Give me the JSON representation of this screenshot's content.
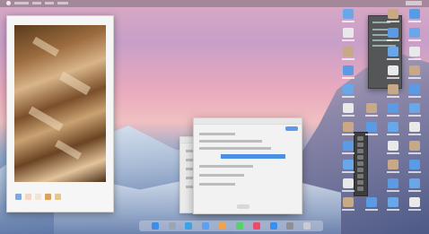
{
  "desktop": {
    "wallpaper": "mountain-landscape",
    "colors": {
      "sky_top": "#d9a9c4",
      "sky_mid": "#f0c0c2",
      "mountain": "#6f88b3"
    }
  },
  "menubar": {
    "items": [
      "",
      "",
      "",
      ""
    ],
    "clock": ""
  },
  "image_window": {
    "artwork": "cubist-painting",
    "swatches": [
      "#7fa7e0",
      "#f3d6c6",
      "#efe4d6",
      "#d9a15e",
      "#e8c68a"
    ]
  },
  "dialog": {
    "title": "",
    "selected_row": "",
    "confirm_label": "",
    "cancel_label": ""
  },
  "panel": {
    "title": ""
  },
  "palette": {
    "tools": [
      "",
      "",
      "",
      "",
      "",
      "",
      "",
      "",
      ""
    ]
  },
  "desktop_icons": [
    {
      "name": "folder-icon",
      "color": "#6aa7e8"
    },
    {
      "name": "document-icon",
      "color": "#e9e9e9"
    },
    {
      "name": "image-icon",
      "color": "#c7a988"
    },
    {
      "name": "folder-icon",
      "color": "#5b9be6"
    }
  ],
  "dock": {
    "apps": [
      "finder-icon",
      "launchpad-icon",
      "safari-icon",
      "mail-icon",
      "photos-icon",
      "messages-icon",
      "music-icon",
      "appstore-icon",
      "settings-icon",
      "trash-icon"
    ],
    "app_colors": [
      "#3d8ee6",
      "#9aa6b8",
      "#3aa3e3",
      "#5ea0ef",
      "#f0a34f",
      "#58d16a",
      "#f04a6a",
      "#3a8ef0",
      "#8e8e93",
      "#c8ccd2"
    ]
  }
}
